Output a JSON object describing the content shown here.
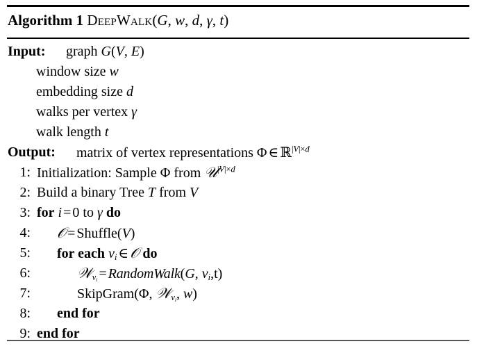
{
  "algorithm": {
    "header": {
      "label": "Algorithm 1",
      "name": "DeepWalk",
      "signature_open": "(",
      "signature_args": [
        "G",
        "w",
        "d",
        "γ",
        "t"
      ],
      "signature_close": ")",
      "full_title": "Algorithm 1 DeepWalk(G, w, d, γ, t)"
    },
    "io": [
      {
        "label": "Input:",
        "text": "graph G(V, E)",
        "kind": "input-head"
      },
      {
        "label": "",
        "text": "window size w",
        "kind": "input-cont"
      },
      {
        "label": "",
        "text": "embedding size d",
        "kind": "input-cont"
      },
      {
        "label": "",
        "text": "walks per vertex γ",
        "kind": "input-cont"
      },
      {
        "label": "",
        "text": "walk length t",
        "kind": "input-cont"
      },
      {
        "label": "Output:",
        "text": "matrix of vertex representations Φ ∈ ℝ^|V|×d",
        "kind": "output-head"
      }
    ],
    "steps": [
      {
        "number": "1:",
        "indent": 0,
        "text": "Initialization: Sample Φ from 𝒰^|V|×d"
      },
      {
        "number": "2:",
        "indent": 0,
        "text": "Build a binary Tree T from V"
      },
      {
        "number": "3:",
        "indent": 0,
        "text": "for i = 0 to γ do"
      },
      {
        "number": "4:",
        "indent": 1,
        "text": "𝒪 = Shuffle(V)"
      },
      {
        "number": "5:",
        "indent": 1,
        "text": "for each v_i ∈ 𝒪 do"
      },
      {
        "number": "6:",
        "indent": 2,
        "text": "𝒲_{v_i} = RandomWalk(G, v_i, t)"
      },
      {
        "number": "7:",
        "indent": 2,
        "text": "SkipGram(Φ, 𝒲_{v_i}, w)"
      },
      {
        "number": "8:",
        "indent": 1,
        "text": "end for"
      },
      {
        "number": "9:",
        "indent": 0,
        "text": "end for"
      }
    ],
    "tokens": {
      "alg_label": "Algorithm 1",
      "alg_name": "DeepWalk",
      "input_label": "Input:",
      "output_label": "Output:",
      "graph_word": "graph",
      "window_size": "window size",
      "embedding_size": "embedding size",
      "walks_per_vertex": "walks per vertex",
      "walk_length": "walk length",
      "matrix_of": "matrix of vertex representations",
      "init_word": "Initialization:",
      "sample_word": "Sample",
      "from_word": "from",
      "build_word": "Build a binary Tree",
      "build_from": "from",
      "for_kw": "for",
      "to_kw": "to",
      "do_kw": "do",
      "for_each_kw": "for each",
      "end_for_kw": "end for",
      "shuffle_fn": "Shuffle",
      "randomwalk_fn": "RandomWalk",
      "skipgram_fn": "SkipGram",
      "var_G": "G",
      "var_V": "V",
      "var_E": "E",
      "var_w": "w",
      "var_d": "d",
      "var_t": "t",
      "var_T": "T",
      "var_i": "i",
      "var_v": "v",
      "var_gamma": "γ",
      "var_Phi": "Φ",
      "var_zero": "0",
      "set_U": "𝒰",
      "set_O": "𝒪",
      "set_W": "𝒲",
      "set_R": "ℝ",
      "op_eq": "=",
      "op_in": "∈",
      "op_times": "×",
      "bar": "|",
      "comma": ",",
      "paren_open": "(",
      "paren_close": ")",
      "num_1": "1:",
      "num_2": "2:",
      "num_3": "3:",
      "num_4": "4:",
      "num_5": "5:",
      "num_6": "6:",
      "num_7": "7:",
      "num_8": "8:",
      "num_9": "9:"
    },
    "colors": {
      "text": "#000000",
      "rule": "#000000",
      "rule_bottom": "#555555",
      "background": "#ffffff"
    }
  }
}
